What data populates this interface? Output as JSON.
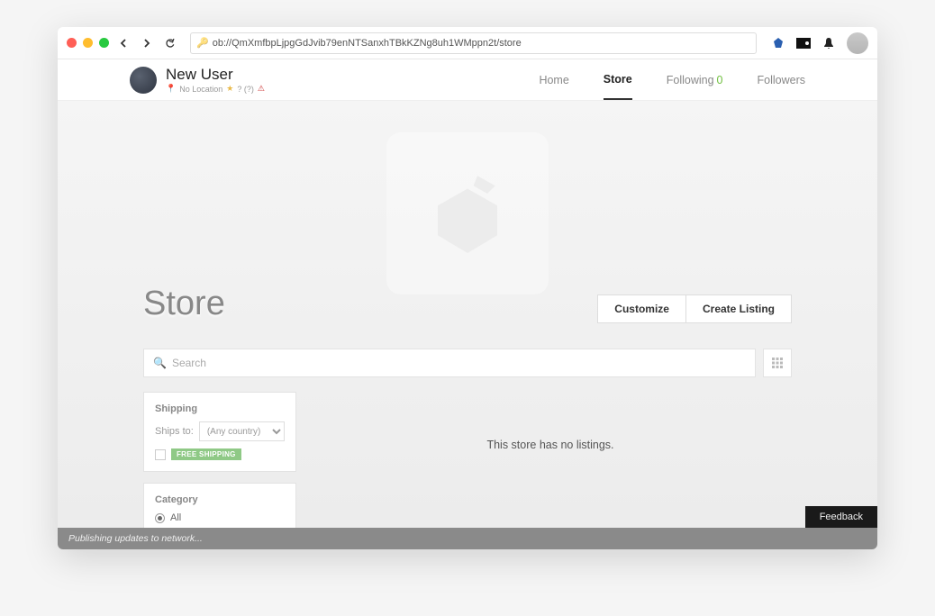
{
  "address": "ob://QmXmfbpLjpgGdJvib79enNTSanxhTBkKZNg8uh1WMppn2t/store",
  "profile": {
    "name": "New User",
    "location": "No Location",
    "rating": "? (?)"
  },
  "nav": {
    "home": "Home",
    "store": "Store",
    "following": "Following",
    "followingCount": "0",
    "followers": "Followers"
  },
  "hero": {
    "title": "Store",
    "customize": "Customize",
    "createListing": "Create Listing"
  },
  "search": {
    "placeholder": "Search"
  },
  "shipping": {
    "title": "Shipping",
    "shipsToLabel": "Ships to:",
    "country": "(Any country)",
    "freeBadge": "FREE SHIPPING"
  },
  "category": {
    "title": "Category",
    "all": "All"
  },
  "emptyMessage": "This store has no listings.",
  "status": "Publishing updates to network...",
  "feedback": "Feedback"
}
